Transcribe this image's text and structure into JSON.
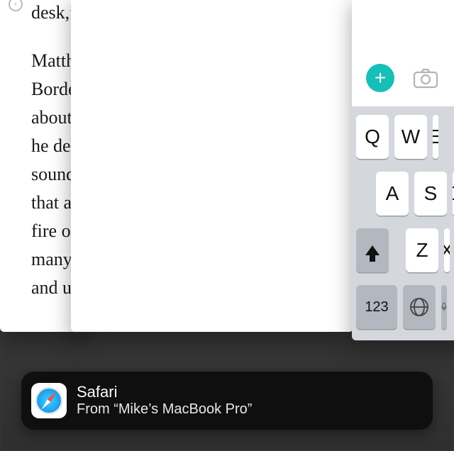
{
  "reader": {
    "line1": "desk,” s",
    "lines": [
      "Matthe",
      "Borderl",
      "about a",
      "he desc",
      "sound:",
      "that as",
      "fire on",
      "many p",
      "and un"
    ]
  },
  "keyboard": {
    "row1": [
      "Q",
      "W",
      "E"
    ],
    "row2": [
      "A",
      "S",
      "D"
    ],
    "row3": [
      "Z",
      "X"
    ],
    "num_key": "123"
  },
  "icons": {
    "plus": "+",
    "camera": "camera-icon",
    "shift": "shift-icon",
    "globe": "globe-icon",
    "mic": "mic-icon",
    "back": "‹"
  },
  "handoff": {
    "app_name": "Safari",
    "subtitle": "From “Mike’s MacBook Pro”"
  }
}
